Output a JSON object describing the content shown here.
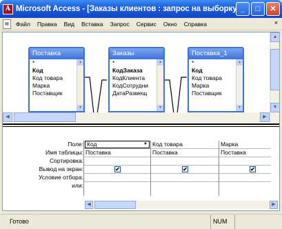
{
  "window": {
    "app_icon": "Ä",
    "title": "Microsoft Access - [Заказы клиентов : запрос на выборку]",
    "minimize": "_",
    "maximize": "□",
    "close": "✕"
  },
  "menu": {
    "items": [
      "Файл",
      "Правка",
      "Вид",
      "Вставка",
      "Запрос",
      "Сервис",
      "Окно",
      "Справка"
    ],
    "close_doc": "×"
  },
  "tables": [
    {
      "title": "Поставка",
      "fields": [
        "*",
        "Код",
        "Код товара",
        "Марка",
        "Поставщик"
      ],
      "key": 1
    },
    {
      "title": "Заказы",
      "fields": [
        "*",
        "КодЗаказа",
        "КодКлиента",
        "КодСотрудни",
        "ДатаРазмещ"
      ],
      "key": 1
    },
    {
      "title": "Поставка_1",
      "fields": [
        "*",
        "Код",
        "Код товара",
        "Марка",
        "Поставщик"
      ],
      "key": 1
    }
  ],
  "grid": {
    "row_labels": [
      "Поле:",
      "Имя таблицы:",
      "Сортировка:",
      "Вывод на экран:",
      "Условие отбора:",
      "или:"
    ],
    "columns": [
      {
        "field": "Код",
        "table": "Поставка",
        "show": true
      },
      {
        "field": "Код товара",
        "table": "Поставка",
        "show": true
      },
      {
        "field": "Марка",
        "table": "Поставка",
        "show": true
      }
    ],
    "check_mark": "✔"
  },
  "status": {
    "ready": "Готово",
    "num": "NUM"
  }
}
